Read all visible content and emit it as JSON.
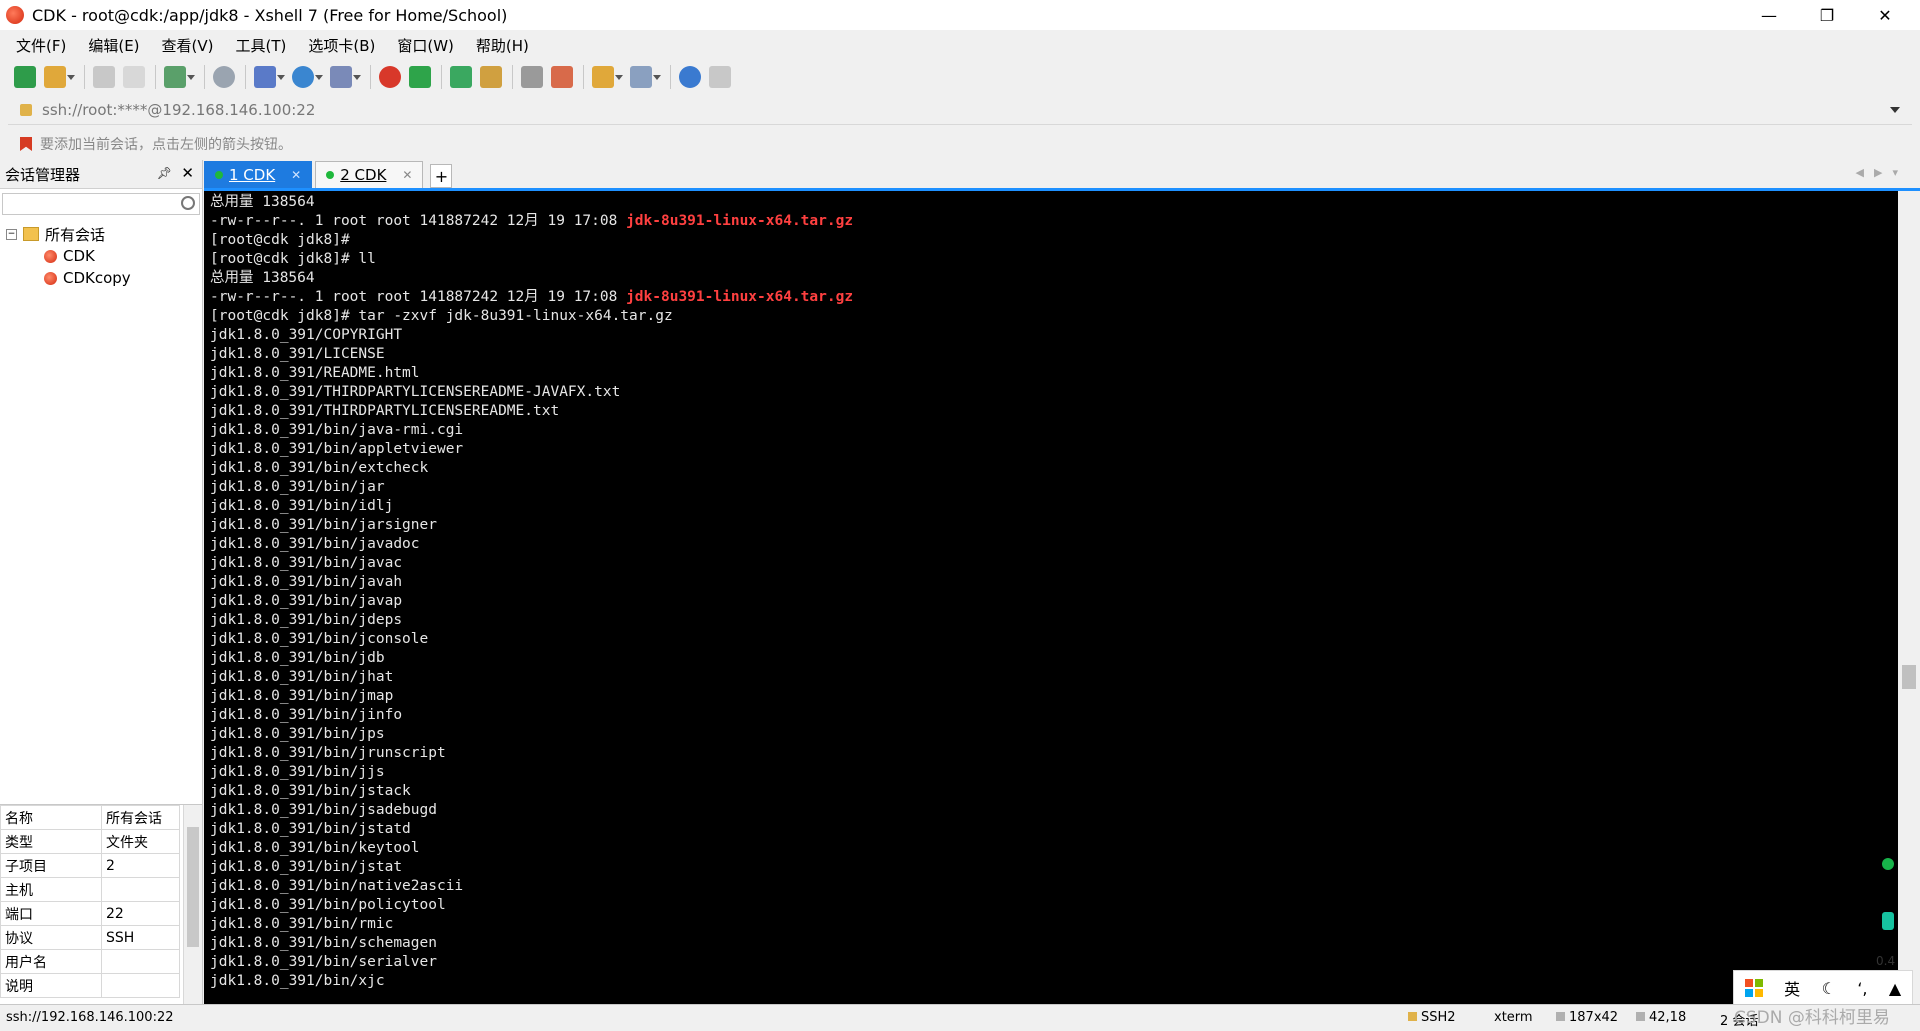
{
  "window": {
    "title": "CDK - root@cdk:/app/jdk8 - Xshell 7 (Free for Home/School)"
  },
  "menu": [
    "文件(F)",
    "编辑(E)",
    "查看(V)",
    "工具(T)",
    "选项卡(B)",
    "窗口(W)",
    "帮助(H)"
  ],
  "address": {
    "url": "ssh://root:****@192.168.146.100:22"
  },
  "hint": {
    "text": "要添加当前会话，点击左侧的箭头按钮。"
  },
  "session_manager": {
    "title": "会话管理器",
    "root": "所有会话",
    "sessions": [
      "CDK",
      "CDKcopy"
    ]
  },
  "properties": [
    {
      "name": "名称",
      "value": "所有会话"
    },
    {
      "name": "类型",
      "value": "文件夹"
    },
    {
      "name": "子项目",
      "value": "2"
    },
    {
      "name": "主机",
      "value": ""
    },
    {
      "name": "端口",
      "value": "22"
    },
    {
      "name": "协议",
      "value": "SSH"
    },
    {
      "name": "用户名",
      "value": ""
    },
    {
      "name": "说明",
      "value": ""
    }
  ],
  "tabs": [
    {
      "label": "1 CDK",
      "active": true
    },
    {
      "label": "2 CDK",
      "active": false
    }
  ],
  "terminal": {
    "lines": [
      [
        "总用量 138564"
      ],
      [
        "-rw-r--r--. 1 root root 141887242 12月 19 17:08 ",
        "jdk-8u391-linux-x64.tar.gz"
      ],
      [
        "[root@cdk jdk8]#"
      ],
      [
        "[root@cdk jdk8]# ll"
      ],
      [
        "总用量 138564"
      ],
      [
        "-rw-r--r--. 1 root root 141887242 12月 19 17:08 ",
        "jdk-8u391-linux-x64.tar.gz"
      ],
      [
        "[root@cdk jdk8]# tar -zxvf jdk-8u391-linux-x64.tar.gz"
      ],
      [
        "jdk1.8.0_391/COPYRIGHT"
      ],
      [
        "jdk1.8.0_391/LICENSE"
      ],
      [
        "jdk1.8.0_391/README.html"
      ],
      [
        "jdk1.8.0_391/THIRDPARTYLICENSEREADME-JAVAFX.txt"
      ],
      [
        "jdk1.8.0_391/THIRDPARTYLICENSEREADME.txt"
      ],
      [
        "jdk1.8.0_391/bin/java-rmi.cgi"
      ],
      [
        "jdk1.8.0_391/bin/appletviewer"
      ],
      [
        "jdk1.8.0_391/bin/extcheck"
      ],
      [
        "jdk1.8.0_391/bin/jar"
      ],
      [
        "jdk1.8.0_391/bin/idlj"
      ],
      [
        "jdk1.8.0_391/bin/jarsigner"
      ],
      [
        "jdk1.8.0_391/bin/javadoc"
      ],
      [
        "jdk1.8.0_391/bin/javac"
      ],
      [
        "jdk1.8.0_391/bin/javah"
      ],
      [
        "jdk1.8.0_391/bin/javap"
      ],
      [
        "jdk1.8.0_391/bin/jdeps"
      ],
      [
        "jdk1.8.0_391/bin/jconsole"
      ],
      [
        "jdk1.8.0_391/bin/jdb"
      ],
      [
        "jdk1.8.0_391/bin/jhat"
      ],
      [
        "jdk1.8.0_391/bin/jmap"
      ],
      [
        "jdk1.8.0_391/bin/jinfo"
      ],
      [
        "jdk1.8.0_391/bin/jps"
      ],
      [
        "jdk1.8.0_391/bin/jrunscript"
      ],
      [
        "jdk1.8.0_391/bin/jjs"
      ],
      [
        "jdk1.8.0_391/bin/jstack"
      ],
      [
        "jdk1.8.0_391/bin/jsadebugd"
      ],
      [
        "jdk1.8.0_391/bin/jstatd"
      ],
      [
        "jdk1.8.0_391/bin/keytool"
      ],
      [
        "jdk1.8.0_391/bin/jstat"
      ],
      [
        "jdk1.8.0_391/bin/native2ascii"
      ],
      [
        "jdk1.8.0_391/bin/policytool"
      ],
      [
        "jdk1.8.0_391/bin/rmic"
      ],
      [
        "jdk1.8.0_391/bin/schemagen"
      ],
      [
        "jdk1.8.0_391/bin/serialver"
      ],
      [
        "jdk1.8.0_391/bin/xjc"
      ]
    ]
  },
  "side_indicator": {
    "value": "0.4"
  },
  "ime": {
    "lang": "英"
  },
  "status": {
    "path": "ssh://192.168.146.100:22",
    "protocol": "SSH2",
    "term": "xterm",
    "size": "187x42",
    "cursor": "42,18",
    "sessions": "2 会话",
    "watermark": "CSDN @科科柯里易"
  },
  "colors": {
    "accent": "#1e7be0",
    "highlight": "#ff4040",
    "terminal_bg": "#000000"
  }
}
